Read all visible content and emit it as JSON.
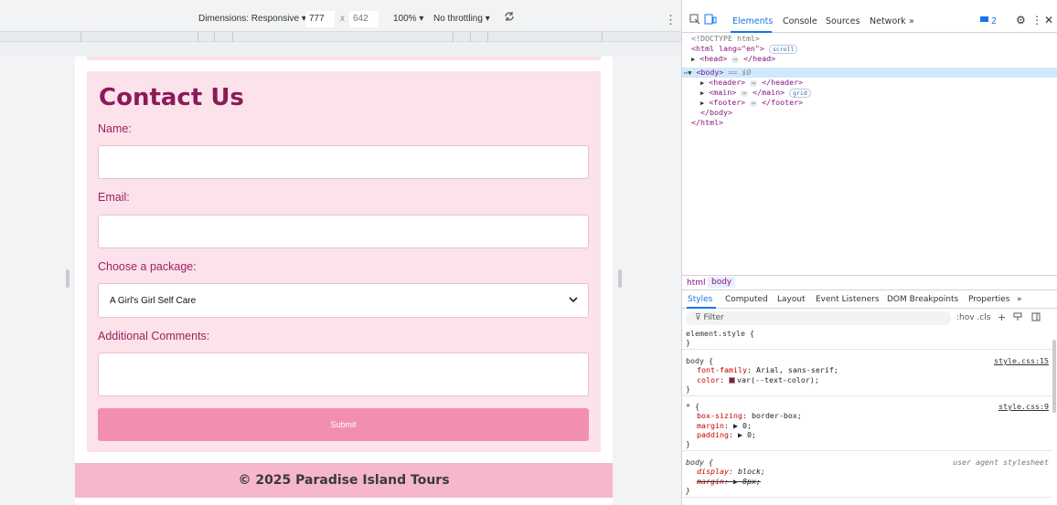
{
  "device_toolbar": {
    "dimensions": "Dimensions: Responsive ▾",
    "width": "777",
    "x": "x",
    "height": "642",
    "zoom": "100% ▾",
    "throttle": "No throttling ▾"
  },
  "page": {
    "contact": {
      "title": "Contact Us",
      "name_label": "Name:",
      "email_label": "Email:",
      "package_label": "Choose a package:",
      "package_value": "A Girl's Girl Self Care",
      "comments_label": "Additional Comments:",
      "submit_label": "Submit"
    },
    "footer": "© 2025 Paradise Island Tours"
  },
  "devtools": {
    "tabs": [
      "Elements",
      "Console",
      "Sources",
      "Network",
      "»"
    ],
    "issues_count": "2",
    "dom": {
      "doctype": "<!DOCTYPE html>",
      "html_open": "<html lang=\"en\">",
      "scroll_badge": "scroll",
      "head": "<head>",
      "head_close": "</head>",
      "body_open": "<body>",
      "body_eq": "== $0",
      "header": "<header>",
      "header_close": "</header>",
      "main": "<main>",
      "main_close": "</main>",
      "grid_badge": "grid",
      "footer": "<footer>",
      "footer_close": "</footer>",
      "body_close": "</body>",
      "html_close": "</html>"
    },
    "breadcrumbs": [
      "html",
      "body"
    ],
    "styles_tabs": [
      "Styles",
      "Computed",
      "Layout",
      "Event Listeners",
      "DOM Breakpoints",
      "Properties",
      "»"
    ],
    "filter_placeholder": "Filter",
    "filter_tools": ":hov .cls",
    "rules": [
      {
        "selector": "element.style {",
        "source": "",
        "props": [],
        "close": "}"
      },
      {
        "selector": "body {",
        "source": "style.css:15",
        "props": [
          {
            "name": "font-family",
            "value": "Arial, sans-serif;"
          },
          {
            "name": "color",
            "value": "var(--text-color);"
          }
        ],
        "close": "}"
      },
      {
        "selector": "* {",
        "source": "style.css:9",
        "props": [
          {
            "name": "box-sizing",
            "value": "border-box;"
          },
          {
            "name": "margin",
            "value": "▶ 0;"
          },
          {
            "name": "padding",
            "value": "▶ 0;"
          }
        ],
        "close": "}"
      },
      {
        "selector": "body {",
        "source": "user agent stylesheet",
        "props": [
          {
            "name": "display",
            "value": "block;"
          },
          {
            "name": "margin",
            "value": "▶ 8px;"
          }
        ],
        "close": "}"
      }
    ]
  },
  "colors": {
    "contact_bg": "#fce2ea",
    "title": "#8b1a5a",
    "label": "#9c2260",
    "submit_bg": "#f28fb1",
    "footer_bg": "#f6b7cd",
    "devtools_accent": "#1a73e8"
  },
  "icons": [
    "chevron-down-icon",
    "rotate-icon",
    "inspect-icon",
    "device-toggle-icon",
    "gear-icon",
    "close-icon",
    "more-icon",
    "filter-icon",
    "issues-icon"
  ]
}
